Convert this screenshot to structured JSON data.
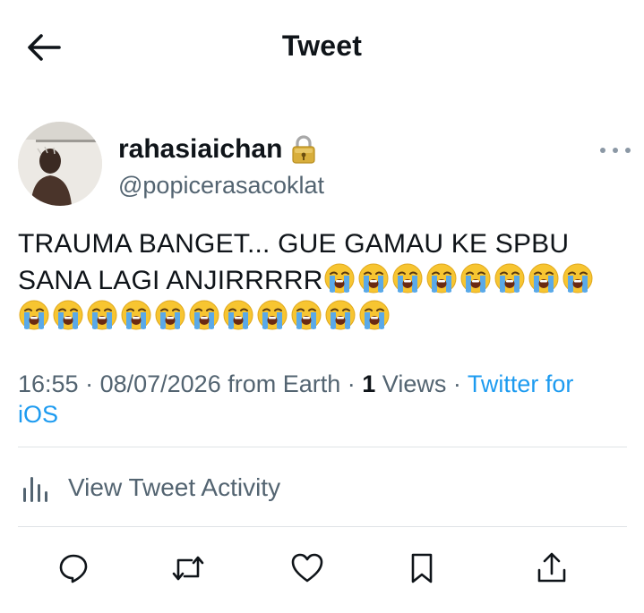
{
  "header": {
    "title": "Tweet",
    "back_icon": "arrow-left-icon"
  },
  "author": {
    "display_name": "rahasiaichan",
    "badge_icon": "lock-icon",
    "handle": "@popicerasacoklat",
    "more_icon": "more-horizontal-icon"
  },
  "tweet": {
    "text_line1": "TRAUMA BANGET... GUE GAMAU KE SPBU",
    "text_line2": "SANA LAGI ANJIRRRRR",
    "emoji_icon": "loudly-crying-face-emoji",
    "emoji_count_line2": 8,
    "emoji_count_line3": 11
  },
  "meta": {
    "time": "16:55",
    "separator": " · ",
    "date": "08/07/2026",
    "location": " from Earth",
    "views_count": "1",
    "views_label": " Views",
    "source_line1": "Twitter for",
    "source_line2": "iOS"
  },
  "activity": {
    "label": "View Tweet Activity",
    "icon": "bar-chart-icon"
  },
  "actions": {
    "reply_icon": "reply-icon",
    "retweet_icon": "retweet-icon",
    "like_icon": "heart-icon",
    "bookmark_icon": "bookmark-icon",
    "share_icon": "share-icon"
  },
  "colors": {
    "text_primary": "#0f1419",
    "text_secondary": "#536471",
    "link": "#1d9bf0",
    "divider": "#dfe3e6",
    "emoji_face": "#f7c531",
    "emoji_tears": "#5aa9e8"
  }
}
